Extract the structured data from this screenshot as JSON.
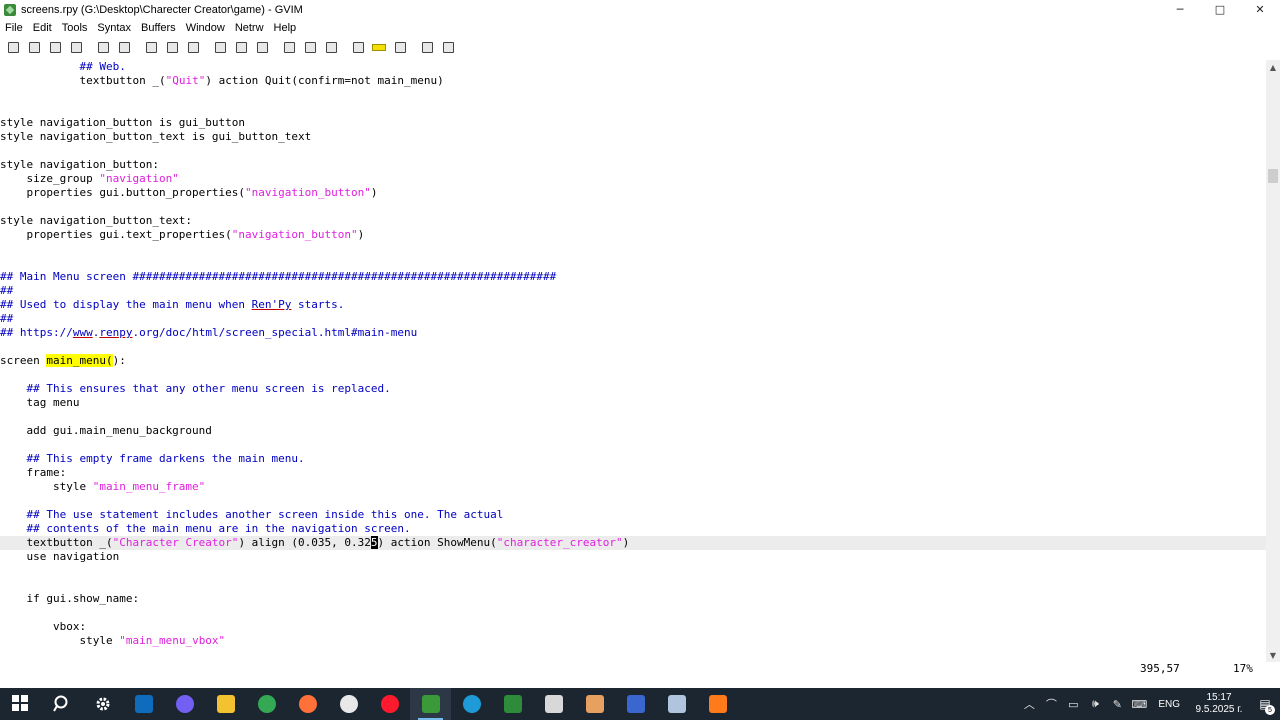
{
  "window": {
    "title": "screens.rpy (G:\\Desktop\\Charecter Creator\\game) - GVIM",
    "minimize": "─",
    "maximize": "□",
    "close": "✕"
  },
  "menubar": [
    "File",
    "Edit",
    "Tools",
    "Syntax",
    "Buffers",
    "Window",
    "Netrw",
    "Help"
  ],
  "toolbar": [
    {
      "icon": "open-icon"
    },
    {
      "icon": "save-icon"
    },
    {
      "icon": "save-all-icon"
    },
    {
      "icon": "print-icon"
    },
    {
      "icon": "undo-icon"
    },
    {
      "icon": "redo-icon"
    },
    {
      "icon": "cut-icon"
    },
    {
      "icon": "copy-icon"
    },
    {
      "icon": "paste-icon"
    },
    {
      "icon": "replace-icon"
    },
    {
      "icon": "find-next-icon"
    },
    {
      "icon": "find-prev-icon"
    },
    {
      "icon": "load-session-icon"
    },
    {
      "icon": "save-session-icon"
    },
    {
      "icon": "run-script-icon"
    },
    {
      "icon": "make-icon"
    },
    {
      "icon": "shell-icon"
    },
    {
      "icon": "ctags-icon"
    },
    {
      "icon": "help-icon"
    },
    {
      "icon": "find-help-icon"
    }
  ],
  "editor": {
    "lines": [
      [
        {
          "t": "            "
        },
        {
          "t": "## Web.",
          "s": "comment"
        }
      ],
      [
        {
          "t": "            textbutton _("
        },
        {
          "t": "\"Quit\"",
          "s": "string"
        },
        {
          "t": ") action Quit(confirm=not main_menu)"
        }
      ],
      [],
      [],
      [
        {
          "t": "style navigation_button is gui_button"
        }
      ],
      [
        {
          "t": "style navigation_button_text is gui_button_text"
        }
      ],
      [],
      [
        {
          "t": "style navigation_button:"
        }
      ],
      [
        {
          "t": "    size_group "
        },
        {
          "t": "\"navigation\"",
          "s": "string"
        }
      ],
      [
        {
          "t": "    properties gui.button_properties("
        },
        {
          "t": "\"navigation_button\"",
          "s": "string"
        },
        {
          "t": ")"
        }
      ],
      [],
      [
        {
          "t": "style navigation_button_text:"
        }
      ],
      [
        {
          "t": "    properties gui.text_properties("
        },
        {
          "t": "\"navigation_button\"",
          "s": "string"
        },
        {
          "t": ")"
        }
      ],
      [],
      [],
      [
        {
          "t": "## Main Menu screen ################################################################",
          "s": "comment"
        }
      ],
      [
        {
          "t": "##",
          "s": "comment"
        }
      ],
      [
        {
          "t": "## Used to display the main menu when ",
          "s": "comment"
        },
        {
          "t": "Ren'Py",
          "s": "url"
        },
        {
          "t": " starts.",
          "s": "comment"
        }
      ],
      [
        {
          "t": "##",
          "s": "comment"
        }
      ],
      [
        {
          "t": "## https://",
          "s": "comment"
        },
        {
          "t": "www",
          "s": "url"
        },
        {
          "t": ".",
          "s": "comment"
        },
        {
          "t": "renpy",
          "s": "url"
        },
        {
          "t": ".org/doc/html/screen_special.html#main-menu",
          "s": "comment"
        }
      ],
      [],
      [
        {
          "t": "screen "
        },
        {
          "t": "main_menu(",
          "s": "hl"
        },
        {
          "t": "):"
        }
      ],
      [],
      [
        {
          "t": "    "
        },
        {
          "t": "## This ensures that any other menu screen is replaced.",
          "s": "comment"
        }
      ],
      [
        {
          "t": "    tag menu"
        }
      ],
      [],
      [
        {
          "t": "    add gui.main_menu_background"
        }
      ],
      [],
      [
        {
          "t": "    "
        },
        {
          "t": "## This empty frame darkens the main menu.",
          "s": "comment"
        }
      ],
      [
        {
          "t": "    frame:"
        }
      ],
      [
        {
          "t": "        style "
        },
        {
          "t": "\"main_menu_frame\"",
          "s": "string"
        }
      ],
      [],
      [
        {
          "t": "    "
        },
        {
          "t": "## The use statement includes another screen inside this one. The actual",
          "s": "comment"
        }
      ],
      [
        {
          "t": "    "
        },
        {
          "t": "## contents of the main menu are in the navigation screen.",
          "s": "comment"
        }
      ],
      [
        {
          "t": "    textbutton _("
        },
        {
          "t": "\"Character Creator\"",
          "s": "string"
        },
        {
          "t": ") align (0.035, 0.32"
        },
        {
          "t": "5",
          "s": "cursor"
        },
        {
          "t": ") action ShowMenu("
        },
        {
          "t": "\"character_creator\"",
          "s": "string"
        },
        {
          "t": ")"
        }
      ],
      [
        {
          "t": "    use navigation"
        }
      ],
      [],
      [],
      [
        {
          "t": "    if gui.show_name:"
        }
      ],
      [],
      [
        {
          "t": "        vbox:"
        }
      ],
      [
        {
          "t": "            style "
        },
        {
          "t": "\"main_menu_vbox\"",
          "s": "string"
        }
      ]
    ],
    "cursor_line_index": 34
  },
  "scrollbar": {
    "up_arrow": "▲",
    "down_arrow": "▼",
    "position_fraction": 0.17
  },
  "status": {
    "position": "395,57",
    "percent": "17%"
  },
  "taskbar": {
    "apps": [
      {
        "icon": "start-icon",
        "color": "#ffffff"
      },
      {
        "icon": "search-icon",
        "color": "#ffffff"
      },
      {
        "icon": "settings-icon",
        "color": "#ffffff"
      },
      {
        "icon": "outlook-icon",
        "color": "#0f6cbd"
      },
      {
        "icon": "viber-icon",
        "color": "#7360f2"
      },
      {
        "icon": "file-explorer-icon",
        "color": "#f2c230"
      },
      {
        "icon": "chrome-icon",
        "color": "#34a853"
      },
      {
        "icon": "firefox-icon",
        "color": "#ff7139"
      },
      {
        "icon": "unknown-app-icon",
        "color": "#e8e8e8"
      },
      {
        "icon": "opera-icon",
        "color": "#ff1b2d"
      },
      {
        "icon": "gvim-icon",
        "color": "#3a9a3a",
        "active": true
      },
      {
        "icon": "edge-icon",
        "color": "#1e9ad6"
      },
      {
        "icon": "pen-app-icon",
        "color": "#2e8b3a"
      },
      {
        "icon": "paint-app-icon",
        "color": "#d8d8d8"
      },
      {
        "icon": "character-app-icon",
        "color": "#e8a060"
      },
      {
        "icon": "floppy-app-icon",
        "color": "#3a66d0"
      },
      {
        "icon": "printer-app-icon",
        "color": "#b0c4de"
      },
      {
        "icon": "orange-app-icon",
        "color": "#ff7a1a"
      }
    ],
    "tray_icons": [
      "chevron-up-icon",
      "network-icon",
      "battery-icon",
      "volume-icon",
      "pen-icon",
      "keyboard-icon"
    ],
    "tray_glyphs": [
      "︿",
      "⌒",
      "▭",
      "🕪",
      "✎",
      "⌨"
    ],
    "language": "ENG",
    "time": "15:17",
    "date": "9.5.2025 г.",
    "notifications_count": "5"
  }
}
